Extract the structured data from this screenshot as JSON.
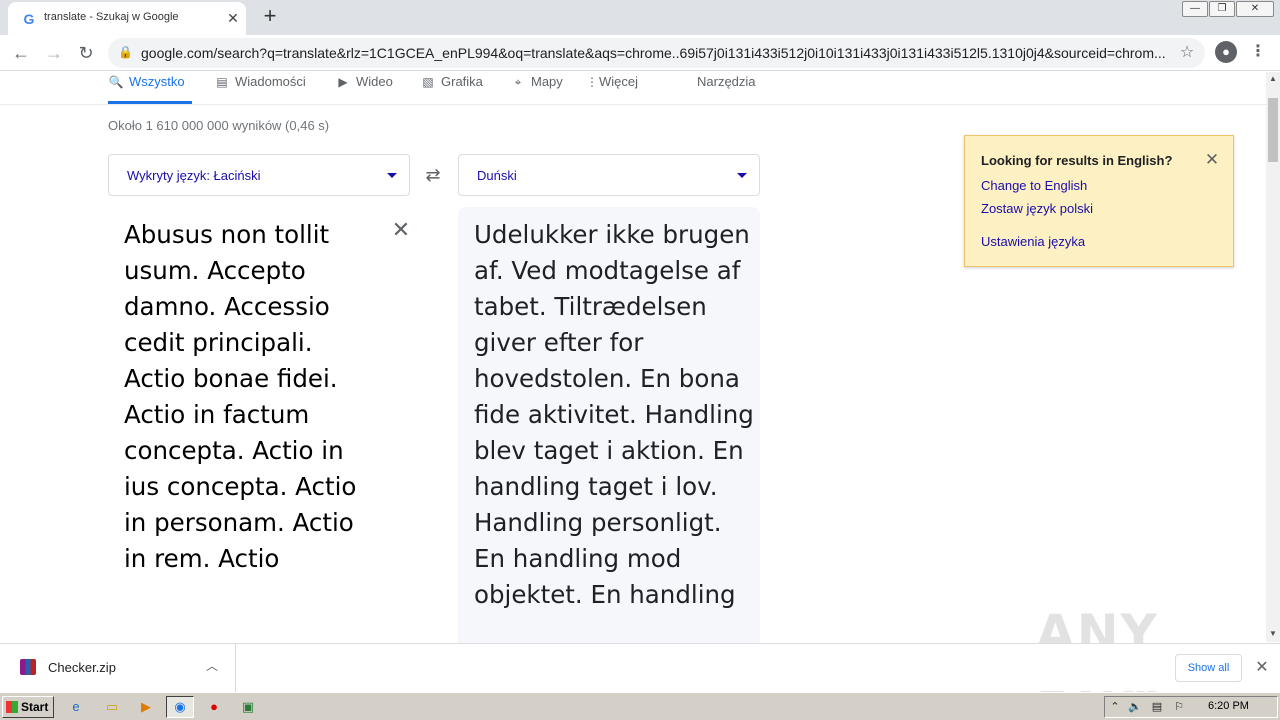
{
  "browser": {
    "tab_title": "translate - Szukaj w Google",
    "favicon": "G",
    "new_tab": "+",
    "url": "google.com/search?q=translate&rlz=1C1GCEA_enPL994&oq=translate&aqs=chrome..69i57j0i131i433i512j0i10i131i433j0i131i433i512l5.1310j0j4&sourceid=chrom..."
  },
  "search_tabs": [
    {
      "label": "Wszystko",
      "icon": "search-icon"
    },
    {
      "label": "Wiadomości",
      "icon": "news-icon"
    },
    {
      "label": "Wideo",
      "icon": "video-icon"
    },
    {
      "label": "Grafika",
      "icon": "image-icon"
    },
    {
      "label": "Mapy",
      "icon": "map-pin-icon"
    },
    {
      "label": "Więcej",
      "icon": "more-vert-icon"
    },
    {
      "label": "Narzędzia",
      "icon": ""
    }
  ],
  "result_stats": "Około 1 610 000 000 wyników (0,46 s)",
  "translate": {
    "source_lang": "Wykryty język: Łaciński",
    "target_lang": "Duński",
    "source_text": "Abusus non tollit usum. Accepto damno. Accessio cedit principali. Actio bonae fidei. Actio in factum concepta. Actio in ius concepta. Actio in personam. Actio in rem. Actio",
    "target_text": "Udelukker ikke brugen af. Ved modtagelse af tabet. Tiltrædelsen giver efter for hovedstolen. En bona fide aktivitet. Handling blev taget i aktion. En handling taget i lov. Handling personligt. En handling mod objektet. En handling"
  },
  "notice": {
    "title": "Looking for results in English?",
    "link_english": "Change to English",
    "link_polish": "Zostaw język polski",
    "link_settings": "Ustawienia języka"
  },
  "downloads": {
    "file_name": "Checker.zip",
    "show_all": "Show all"
  },
  "watermark": "ANY RUN",
  "taskbar": {
    "start": "Start",
    "clock": "6:20 PM"
  },
  "colors": {
    "link": "#1a0dab",
    "accent": "#1a73e8",
    "notice_bg": "#fdf1c3"
  }
}
